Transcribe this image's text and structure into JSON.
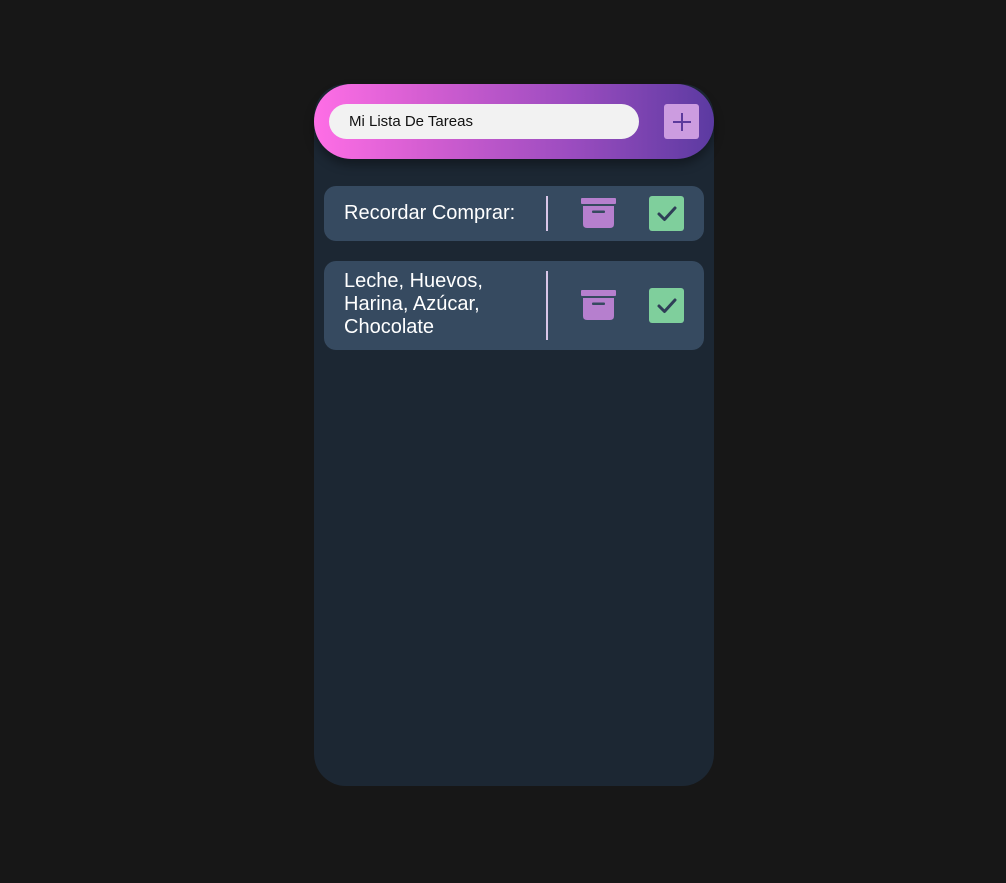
{
  "header": {
    "title_value": "Mi Lista De Tareas",
    "add_icon": "plus-icon"
  },
  "tasks": [
    {
      "text": "Recordar Comprar:",
      "archive_icon": "archive-icon",
      "complete_icon": "check-icon"
    },
    {
      "text": "Leche, Huevos, Harina, Azúcar, Chocolate",
      "archive_icon": "archive-icon",
      "complete_icon": "check-icon"
    }
  ],
  "colors": {
    "page_background": "#171717",
    "panel_background": "#1c2733",
    "task_background": "#364a60",
    "header_gradient_start": "#ff6ee6",
    "header_gradient_end": "#5b3aa1",
    "archive_color": "#b67fce",
    "check_background": "#7fcf9c",
    "check_mark": "#2f3e57"
  }
}
